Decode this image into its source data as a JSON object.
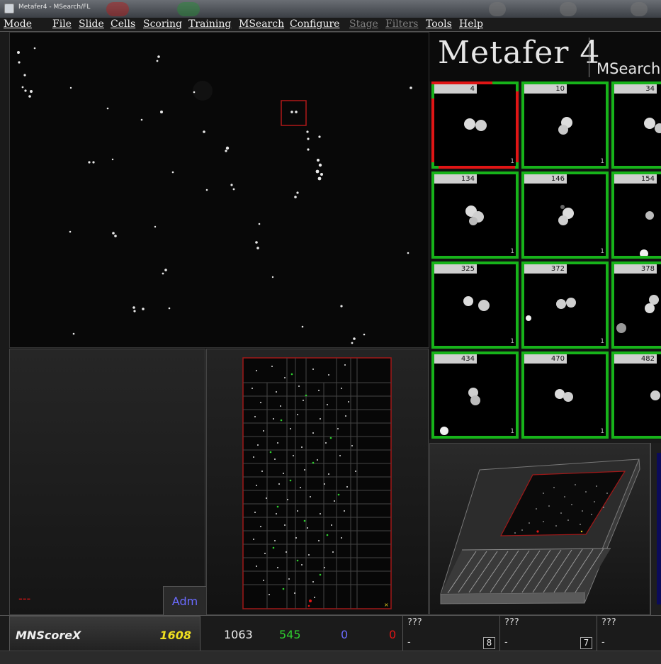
{
  "window": {
    "title": "Metafer4 - MSearch/FL"
  },
  "menu": [
    {
      "label": "Mode",
      "enabled": true
    },
    {
      "label": "File",
      "enabled": true
    },
    {
      "label": "Slide",
      "enabled": true
    },
    {
      "label": "Cells",
      "enabled": true
    },
    {
      "label": "Scoring",
      "enabled": true
    },
    {
      "label": "Training",
      "enabled": true
    },
    {
      "label": "MSearch",
      "enabled": true
    },
    {
      "label": "Configure",
      "enabled": true
    },
    {
      "label": "Stage",
      "enabled": false
    },
    {
      "label": "Filters",
      "enabled": false
    },
    {
      "label": "Tools",
      "enabled": true
    },
    {
      "label": "Help",
      "enabled": true
    }
  ],
  "brand": {
    "name": "Metafer 4",
    "module": "MSearch"
  },
  "gallery": {
    "tiles": [
      {
        "id": "4",
        "count": "1",
        "selected": true
      },
      {
        "id": "10",
        "count": "1",
        "selected": false
      },
      {
        "id": "34",
        "count": "",
        "selected": false
      },
      {
        "id": "134",
        "count": "1",
        "selected": false
      },
      {
        "id": "146",
        "count": "1",
        "selected": false
      },
      {
        "id": "154",
        "count": "",
        "selected": false
      },
      {
        "id": "325",
        "count": "1",
        "selected": false
      },
      {
        "id": "372",
        "count": "1",
        "selected": false
      },
      {
        "id": "378",
        "count": "",
        "selected": false
      },
      {
        "id": "434",
        "count": "1",
        "selected": false
      },
      {
        "id": "470",
        "count": "1",
        "selected": false
      },
      {
        "id": "482",
        "count": "",
        "selected": false
      }
    ]
  },
  "left_panel": {
    "status": "---",
    "adm_label": "Adm"
  },
  "status": {
    "classifier": "MNScoreX",
    "total": "1608",
    "counts": {
      "white": "1063",
      "green": "545",
      "blue": "0",
      "red": "0"
    },
    "slots": [
      {
        "title": "???",
        "detail": "-",
        "number": "8"
      },
      {
        "title": "???",
        "detail": "-",
        "number": "7"
      },
      {
        "title": "???",
        "detail": "-",
        "number": ""
      }
    ]
  },
  "colors": {
    "accent_green": "#17b31a",
    "accent_red": "#e01515",
    "accent_yellow": "#f0e020",
    "accent_blue": "#6b6bff"
  }
}
